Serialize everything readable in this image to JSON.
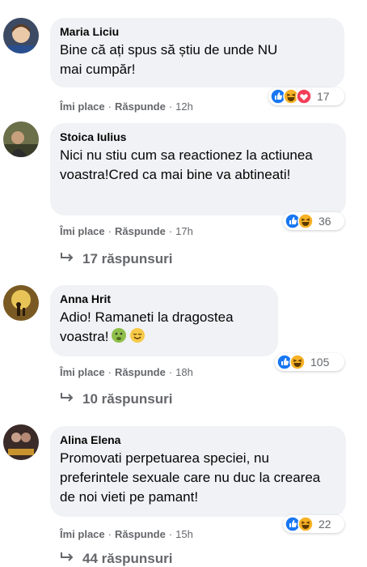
{
  "comments": [
    {
      "author": "Maria Liciu",
      "text": "Bine că ați spus să știu de unde NU mai cumpăr!",
      "like_label": "Îmi place",
      "reply_label": "Răspunde",
      "time": "12h",
      "reaction_count": "17",
      "reactions": [
        "like-icon",
        "haha-icon",
        "love-icon"
      ]
    },
    {
      "author": "Stoica Iulius",
      "text": "Nici nu stiu cum sa reactionez la actiunea voastra!Cred ca mai bine va abtineati!",
      "like_label": "Îmi place",
      "reply_label": "Răspunde",
      "time": "17h",
      "reaction_count": "36",
      "reactions": [
        "like-icon",
        "haha-icon"
      ],
      "replies": "17 răspunsuri"
    },
    {
      "author": "Anna Hrit",
      "text": "Adio! Ramaneti la dragostea voastra!",
      "text_emojis": [
        "nauseated-face",
        "relieved-face"
      ],
      "like_label": "Îmi place",
      "reply_label": "Răspunde",
      "time": "18h",
      "reaction_count": "105",
      "reactions": [
        "like-icon",
        "haha-icon"
      ],
      "replies": "10 răspunsuri"
    },
    {
      "author": "Alina Elena",
      "text": "Promovati perpetuarea speciei, nu preferintele sexuale care nu duc la crearea de noi vieti pe pamant!",
      "like_label": "Îmi place",
      "reply_label": "Răspunde",
      "time": "15h",
      "reaction_count": "22",
      "reactions": [
        "like-icon",
        "haha-icon"
      ],
      "replies": "44 răspunsuri"
    }
  ],
  "colors": {
    "bubble": "#f0f2f5",
    "secondary_text": "#65676b",
    "like_blue": "#1877f2",
    "haha_yellow": "#f7b125",
    "love_red": "#f33e58"
  }
}
